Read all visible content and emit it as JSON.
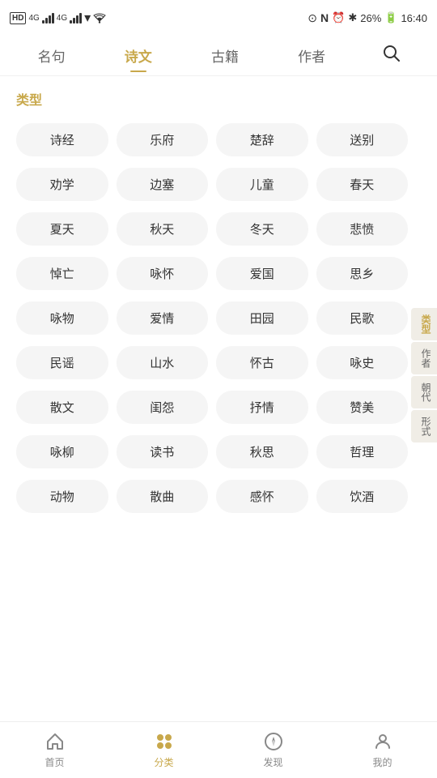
{
  "status": {
    "left_icons": [
      "HD",
      "4G",
      "4G",
      "wifi"
    ],
    "time": "16:40",
    "battery": "26%",
    "icons_right": [
      "eye",
      "N",
      "alarm",
      "bluetooth"
    ]
  },
  "nav": {
    "items": [
      {
        "label": "名句",
        "active": false
      },
      {
        "label": "诗文",
        "active": true
      },
      {
        "label": "古籍",
        "active": false
      },
      {
        "label": "作者",
        "active": false
      }
    ],
    "search_label": "search"
  },
  "section": {
    "title": "类型"
  },
  "tags": [
    "诗经",
    "乐府",
    "楚辞",
    "送别",
    "劝学",
    "边塞",
    "儿童",
    "春天",
    "夏天",
    "秋天",
    "冬天",
    "悲愤",
    "悼亡",
    "咏怀",
    "爱国",
    "思乡",
    "咏物",
    "爱情",
    "田园",
    "民歌",
    "民谣",
    "山水",
    "怀古",
    "咏史",
    "散文",
    "闺怨",
    "抒情",
    "赞美",
    "咏柳",
    "读书",
    "秋思",
    "哲理",
    "动物",
    "散曲",
    "感怀",
    "饮酒"
  ],
  "side_nav": [
    {
      "label": "类型",
      "active": true
    },
    {
      "label": "作者",
      "active": false
    },
    {
      "label": "朝代",
      "active": false
    },
    {
      "label": "形式",
      "active": false
    }
  ],
  "bottom_nav": [
    {
      "label": "首页",
      "active": false,
      "icon": "home"
    },
    {
      "label": "分类",
      "active": true,
      "icon": "category"
    },
    {
      "label": "发现",
      "active": false,
      "icon": "discover"
    },
    {
      "label": "我的",
      "active": false,
      "icon": "mine"
    }
  ]
}
